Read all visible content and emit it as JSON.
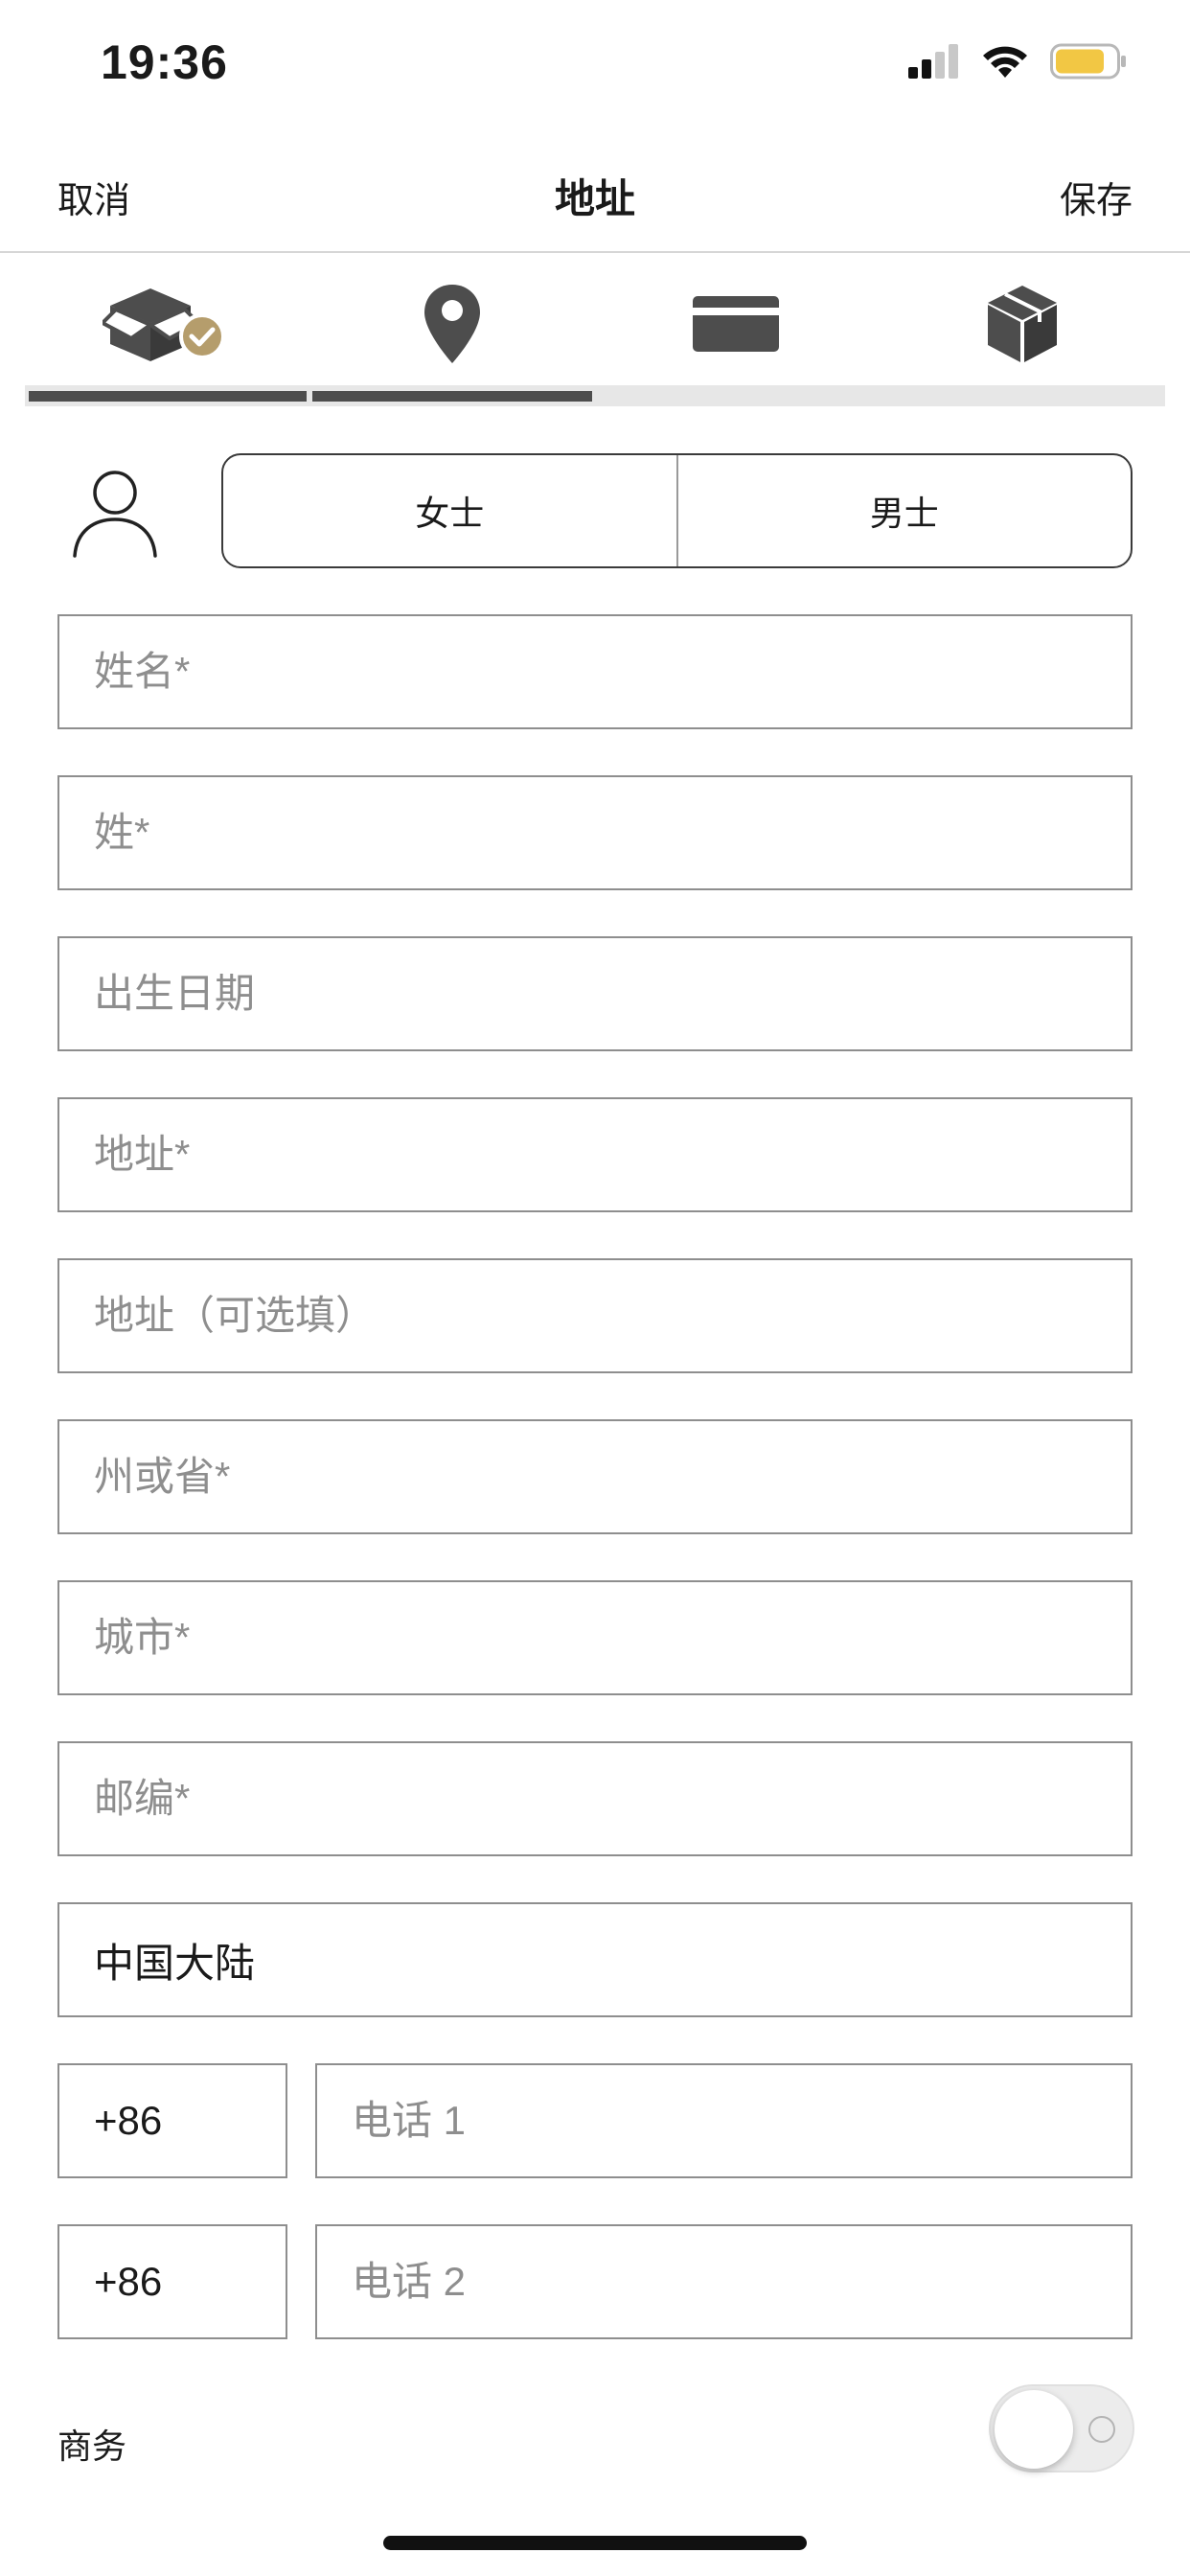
{
  "status": {
    "time": "19:36"
  },
  "nav": {
    "cancel": "取消",
    "title": "地址",
    "save": "保存"
  },
  "steps": [
    {
      "icon": "open-box-check-icon",
      "done": true
    },
    {
      "icon": "location-pin-icon",
      "done": true
    },
    {
      "icon": "credit-card-icon",
      "done": false
    },
    {
      "icon": "package-icon",
      "done": false
    }
  ],
  "progress": {
    "completed_steps": 2,
    "total_steps": 4
  },
  "gender": {
    "options": [
      "女士",
      "男士"
    ]
  },
  "fields": {
    "first_name": {
      "placeholder": "姓名*",
      "value": ""
    },
    "last_name": {
      "placeholder": "姓*",
      "value": ""
    },
    "birth_date": {
      "placeholder": "出生日期",
      "value": ""
    },
    "address": {
      "placeholder": "地址*",
      "value": ""
    },
    "address_optional": {
      "placeholder": "地址（可选填）",
      "value": ""
    },
    "state": {
      "placeholder": "州或省*",
      "value": ""
    },
    "city": {
      "placeholder": "城市*",
      "value": ""
    },
    "postal_code": {
      "placeholder": "邮编*",
      "value": ""
    }
  },
  "country": {
    "value": "中国大陆"
  },
  "phones": [
    {
      "code": "+86",
      "placeholder": "电话 1",
      "value": ""
    },
    {
      "code": "+86",
      "placeholder": "电话 2",
      "value": ""
    }
  ],
  "business": {
    "label": "商务",
    "enabled": false
  },
  "colors": {
    "accent_gold": "#b59d6c",
    "icon_dark": "#4d4d4d",
    "border": "#8e8e8e"
  }
}
